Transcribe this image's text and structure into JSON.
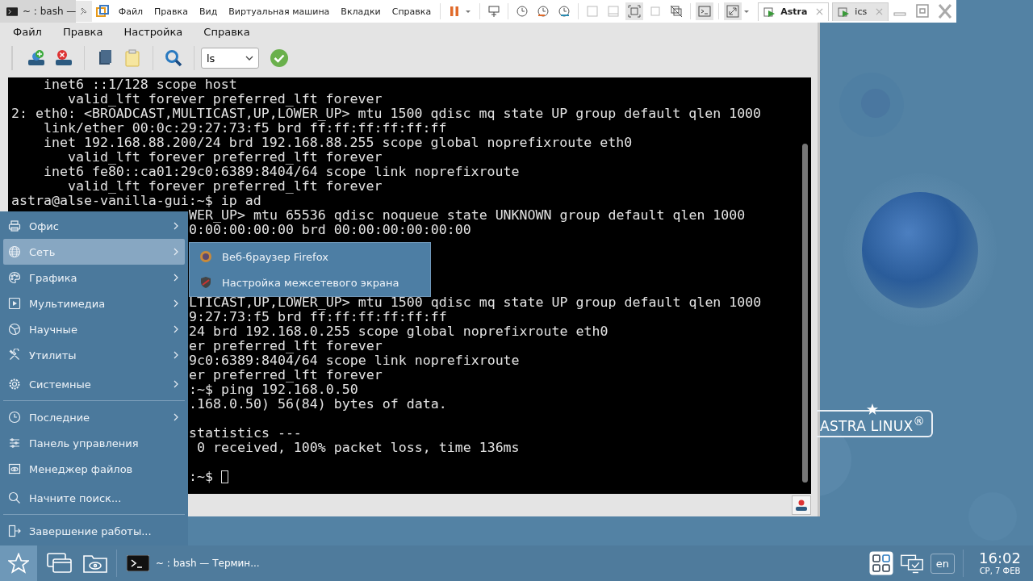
{
  "vm_bar": {
    "host_tab": "~ : bash —",
    "menu": [
      "Файл",
      "Правка",
      "Вид",
      "Виртуальная машина",
      "Вкладки",
      "Справка"
    ],
    "tabs": [
      {
        "label": "Astra",
        "selected": true
      },
      {
        "label": "ics",
        "selected": false
      }
    ]
  },
  "terminal": {
    "menu": [
      "Файл",
      "Правка",
      "Настройка",
      "Справка"
    ],
    "command_combo": {
      "value": "ls"
    },
    "lines": [
      {
        "kind": "full",
        "text": "    inet6 ::1/128 scope host"
      },
      {
        "kind": "full",
        "text": "       valid_lft forever preferred_lft forever"
      },
      {
        "kind": "full",
        "text": "2: eth0: <BROADCAST,MULTICAST,UP,LOWER_UP> mtu 1500 qdisc mq state UP group default qlen 1000"
      },
      {
        "kind": "full",
        "text": "    link/ether 00:0c:29:27:73:f5 brd ff:ff:ff:ff:ff:ff"
      },
      {
        "kind": "full",
        "text": "    inet 192.168.88.200/24 brd 192.168.88.255 scope global noprefixroute eth0"
      },
      {
        "kind": "full",
        "text": "       valid_lft forever preferred_lft forever"
      },
      {
        "kind": "full",
        "text": "    inet6 fe80::ca01:29c0:6389:8404/64 scope link noprefixroute"
      },
      {
        "kind": "full",
        "text": "       valid_lft forever preferred_lft forever"
      },
      {
        "kind": "full",
        "text": "astra@alse-vanilla-gui:~$ ip ad"
      },
      {
        "kind": "right_part",
        "text": "WER_UP> mtu 65536 qdisc noqueue state UNKNOWN group default qlen 1000"
      },
      {
        "kind": "right_part",
        "text": "0:00:00:00:00 brd 00:00:00:00:00:00"
      },
      {
        "kind": "covered"
      },
      {
        "kind": "covered"
      },
      {
        "kind": "covered"
      },
      {
        "kind": "covered"
      },
      {
        "kind": "right_part",
        "text": "LTICAST,UP,LOWER_UP> mtu 1500 qdisc mq state UP group default qlen 1000"
      },
      {
        "kind": "right_part",
        "text": "9:27:73:f5 brd ff:ff:ff:ff:ff:ff"
      },
      {
        "kind": "right_part",
        "text": "24 brd 192.168.0.255 scope global noprefixroute eth0"
      },
      {
        "kind": "right_part",
        "text": "er preferred_lft forever"
      },
      {
        "kind": "right_part",
        "text": "9c0:6389:8404/64 scope link noprefixroute"
      },
      {
        "kind": "right_part",
        "text": "er preferred_lft forever"
      },
      {
        "kind": "right_part",
        "text": ":~$ ping 192.168.0.50"
      },
      {
        "kind": "right_part",
        "text": ".168.0.50) 56(84) bytes of data."
      },
      {
        "kind": "blank"
      },
      {
        "kind": "right_part",
        "text": "statistics ---"
      },
      {
        "kind": "right_part",
        "text": " 0 received, 100% packet loss, time 136ms"
      },
      {
        "kind": "blank"
      },
      {
        "kind": "prompt",
        "text": ":~$ "
      }
    ]
  },
  "start_menu": {
    "items": [
      {
        "label": "Офис",
        "submenu": true,
        "selected": false,
        "separator_after": false
      },
      {
        "label": "Сеть",
        "submenu": true,
        "selected": true,
        "separator_after": false
      },
      {
        "label": "Графика",
        "submenu": true,
        "selected": false,
        "separator_after": false
      },
      {
        "label": "Мультимедиа",
        "submenu": true,
        "selected": false,
        "separator_after": false
      },
      {
        "label": "Научные",
        "submenu": true,
        "selected": false,
        "separator_after": false
      },
      {
        "label": "Утилиты",
        "submenu": true,
        "selected": false,
        "separator_after": false
      },
      {
        "label": "Системные",
        "submenu": true,
        "selected": false,
        "separator_after": true
      },
      {
        "label": "Последние",
        "submenu": true,
        "selected": false,
        "separator_after": false
      },
      {
        "label": "Панель управления",
        "submenu": false,
        "selected": false,
        "separator_after": false
      },
      {
        "label": "Менеджер файлов",
        "submenu": false,
        "selected": false,
        "separator_after": false
      },
      {
        "label": "Начните поиск...",
        "submenu": false,
        "selected": false,
        "separator_after": true
      },
      {
        "label": "Завершение работы...",
        "submenu": false,
        "selected": false,
        "separator_after": false
      }
    ]
  },
  "submenu": {
    "items": [
      {
        "label": "Веб-браузер Firefox"
      },
      {
        "label": "Настройка межсетевого экрана"
      }
    ]
  },
  "desktop": {
    "logo": "ASTRA LINUX$^{®}$"
  },
  "taskbar": {
    "tasks": [
      {
        "label": "~ : bash — Термин..."
      }
    ],
    "language": "en",
    "time": "16:02",
    "date": "СР, 7 ФЕВ"
  }
}
